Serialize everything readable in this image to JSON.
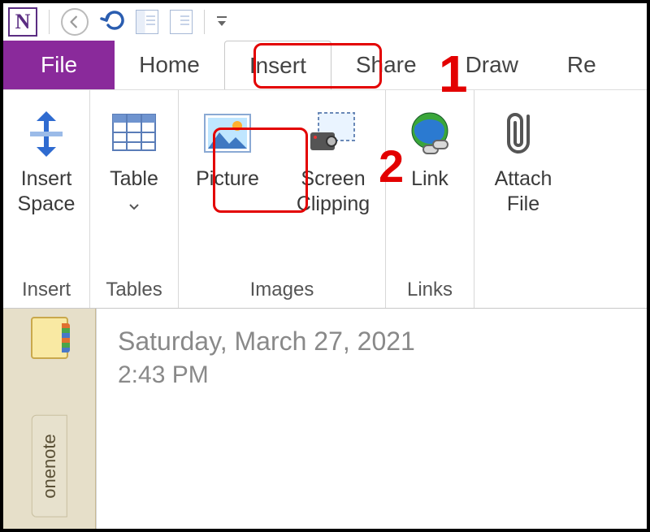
{
  "app": {
    "name": "OneNote",
    "logo_letter": "N"
  },
  "qat": {
    "dropdown_title": "Customize Quick Access Toolbar"
  },
  "tabs": {
    "file": "File",
    "list": [
      "Home",
      "Insert",
      "Share",
      "Draw",
      "Re"
    ],
    "active_index": 1
  },
  "ribbon": {
    "groups": [
      {
        "label": "Insert",
        "buttons": [
          {
            "id": "insert-space",
            "label": "Insert Space"
          }
        ]
      },
      {
        "label": "Tables",
        "buttons": [
          {
            "id": "table",
            "label": "Table",
            "has_menu": true
          }
        ]
      },
      {
        "label": "Images",
        "buttons": [
          {
            "id": "picture",
            "label": "Picture"
          },
          {
            "id": "screen-clipping",
            "label": "Screen Clipping"
          }
        ]
      },
      {
        "label": "Links",
        "buttons": [
          {
            "id": "link",
            "label": "Link"
          }
        ]
      },
      {
        "label": "",
        "buttons": [
          {
            "id": "attach-file",
            "label": "Attach File"
          }
        ]
      }
    ]
  },
  "page": {
    "date": "Saturday, March 27, 2021",
    "time": "2:43 PM",
    "section_name": "onenote"
  },
  "annotations": {
    "c1": "1",
    "c2": "2"
  }
}
